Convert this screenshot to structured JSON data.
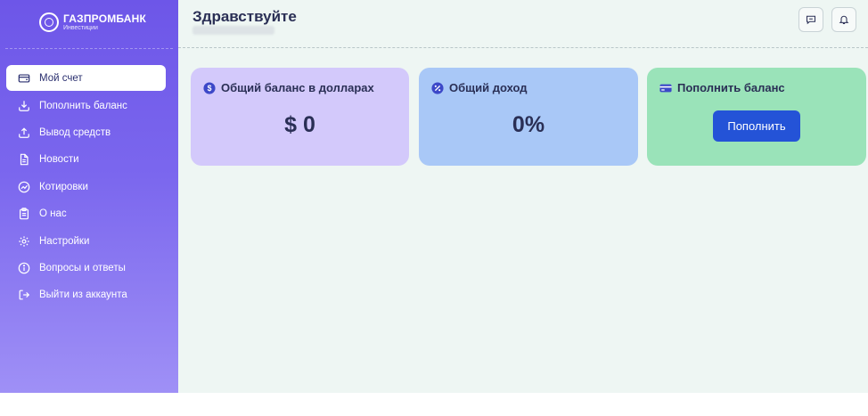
{
  "brand": {
    "name": "ГАЗПРОМБАНК",
    "subtitle": "Инвестиции"
  },
  "header": {
    "greeting": "Здравствуйте",
    "chat_icon": "chat-icon",
    "bell_icon": "bell-icon"
  },
  "sidebar": {
    "items": [
      {
        "label": "Мой счет",
        "icon": "wallet-icon",
        "active": true
      },
      {
        "label": "Пополнить баланс",
        "icon": "deposit-icon"
      },
      {
        "label": "Вывод средств",
        "icon": "withdraw-icon"
      },
      {
        "label": "Новости",
        "icon": "news-icon"
      },
      {
        "label": "Котировки",
        "icon": "quotes-icon"
      },
      {
        "label": "О нас",
        "icon": "clipboard-icon"
      },
      {
        "label": "Настройки",
        "icon": "gear-icon"
      },
      {
        "label": "Вопросы и ответы",
        "icon": "info-icon"
      },
      {
        "label": "Выйти из аккаунта",
        "icon": "logout-icon"
      }
    ]
  },
  "cards": {
    "balance": {
      "title": "Общий баланс в долларах",
      "value": "$ 0",
      "icon": "dollar-icon",
      "color": "#d3c9fb"
    },
    "income": {
      "title": "Общий доход",
      "value": "0%",
      "icon": "percent-icon",
      "color": "#a9c8f7"
    },
    "topup": {
      "title": "Пополнить баланс",
      "button_label": "Пополнить",
      "icon": "card-icon",
      "color": "#9ae3b9"
    }
  },
  "colors": {
    "accent": "#2453d7",
    "sidebar": "#6d56e8",
    "background": "#eef6f3",
    "text": "#2a2f55"
  }
}
